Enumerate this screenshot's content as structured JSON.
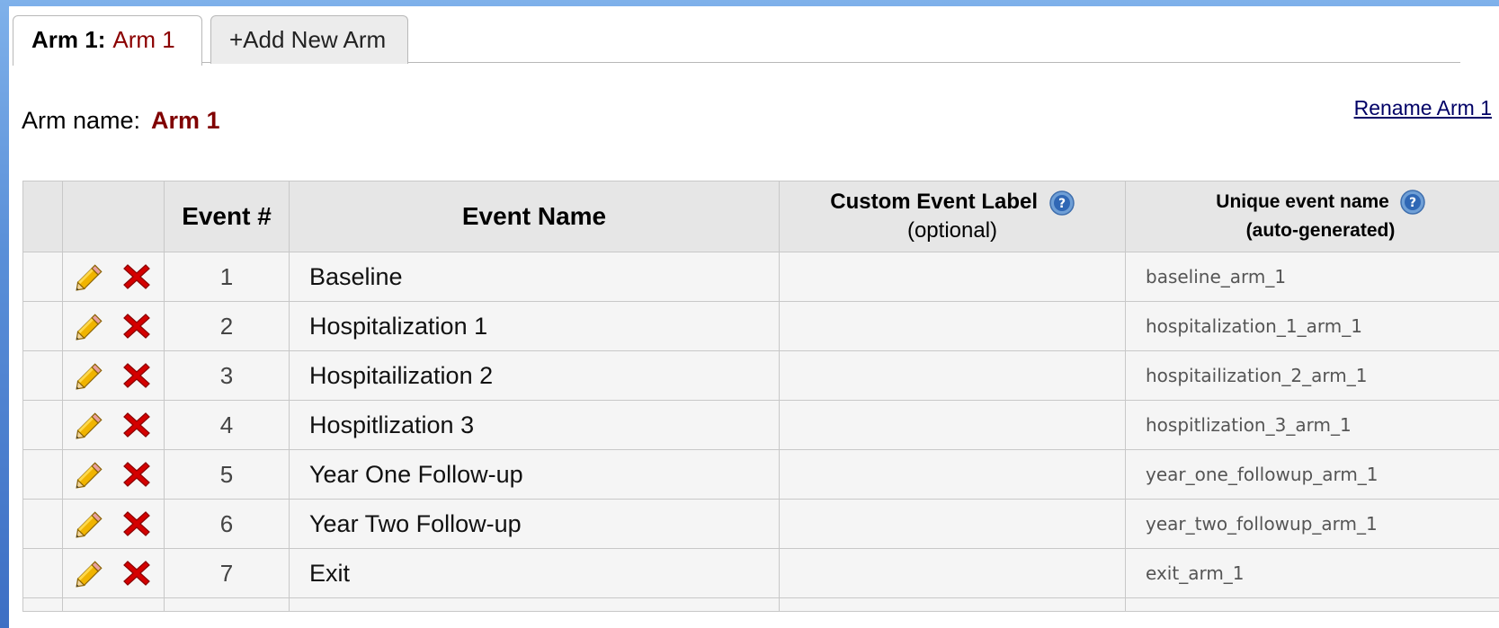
{
  "tabs": {
    "active": {
      "prefix": "Arm 1:",
      "name": "Arm 1"
    },
    "add_label": "+Add New Arm"
  },
  "arm": {
    "label": "Arm name:",
    "name": "Arm 1",
    "rename_link": "Rename Arm 1"
  },
  "table": {
    "headers": {
      "event_num": "Event #",
      "event_name": "Event Name",
      "custom_label": "Custom Event Label",
      "custom_label_sub": "(optional)",
      "unique_name": "Unique event name",
      "unique_name_sub": "(auto-generated)"
    },
    "rows": [
      {
        "num": "1",
        "name": "Baseline",
        "label": "",
        "unique": "baseline_arm_1"
      },
      {
        "num": "2",
        "name": "Hospitalization 1",
        "label": "",
        "unique": "hospitalization_1_arm_1"
      },
      {
        "num": "3",
        "name": "Hospitailization 2",
        "label": "",
        "unique": "hospitailization_2_arm_1"
      },
      {
        "num": "4",
        "name": "Hospitlization 3",
        "label": "",
        "unique": "hospitlization_3_arm_1"
      },
      {
        "num": "5",
        "name": "Year One Follow-up",
        "label": "",
        "unique": "year_one_followup_arm_1"
      },
      {
        "num": "6",
        "name": "Year Two Follow-up",
        "label": "",
        "unique": "year_two_followup_arm_1"
      },
      {
        "num": "7",
        "name": "Exit",
        "label": "",
        "unique": "exit_arm_1"
      }
    ]
  },
  "icons": {
    "edit": "pencil-icon",
    "delete": "delete-x-icon",
    "help": "help-icon"
  },
  "colors": {
    "accent": "#800000",
    "link": "#000066",
    "header_bg": "#e6e6e6",
    "delete": "#cc0000"
  }
}
